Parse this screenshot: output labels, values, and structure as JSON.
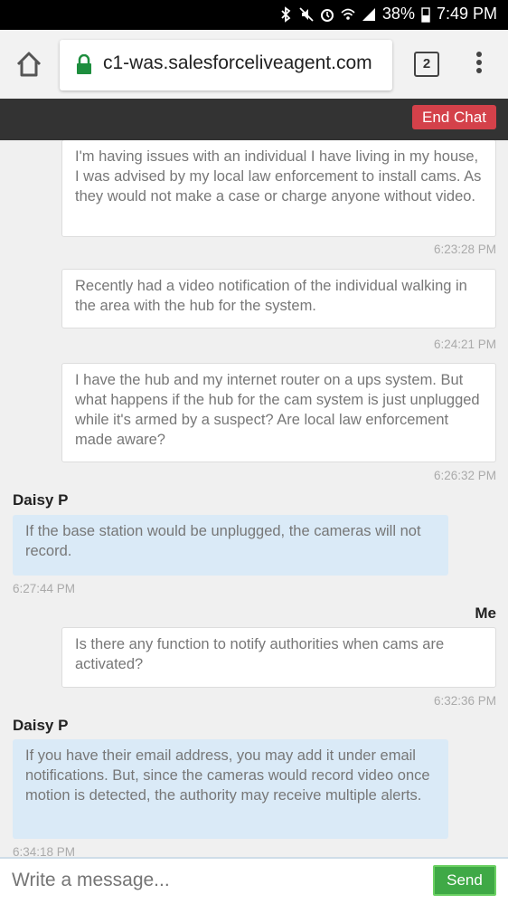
{
  "status_bar": {
    "battery": "38%",
    "time": "7:49 PM"
  },
  "browser": {
    "url": "c1-was.salesforceliveagent.com",
    "tab_count": "2"
  },
  "chat": {
    "end_chat_label": "End Chat",
    "messages": [
      {
        "from": "me",
        "text": "I'm having issues with an individual I have living in my house, I was advised by my local law enforcement to install cams. As they would not make a case or charge anyone without video.",
        "time": "6:23:28 PM"
      },
      {
        "from": "me",
        "text": "Recently had a video notification of the individual walking in the area with the hub for the system.",
        "time": "6:24:21 PM"
      },
      {
        "from": "me",
        "text": "I have the hub and my internet router on a ups system. But what happens if the hub for the cam system is just unplugged while it's armed by a suspect? Are local law enforcement made aware?",
        "time": "6:26:32 PM"
      },
      {
        "from": "agent",
        "sender": "Daisy P",
        "text": "If the base station would be unplugged, the cameras will not record.",
        "time": "6:27:44 PM"
      },
      {
        "from": "me",
        "sender": "Me",
        "text": "Is there any function to notify authorities when cams are activated?",
        "time": "6:32:36 PM"
      },
      {
        "from": "agent",
        "sender": "Daisy P",
        "text": "If you have their email address, you may add it under email notifications. But, since the cameras would record video once motion is detected, the authority may receive multiple alerts.",
        "time": "6:34:18 PM"
      }
    ]
  },
  "composer": {
    "placeholder": "Write a message...",
    "send_label": "Send"
  }
}
